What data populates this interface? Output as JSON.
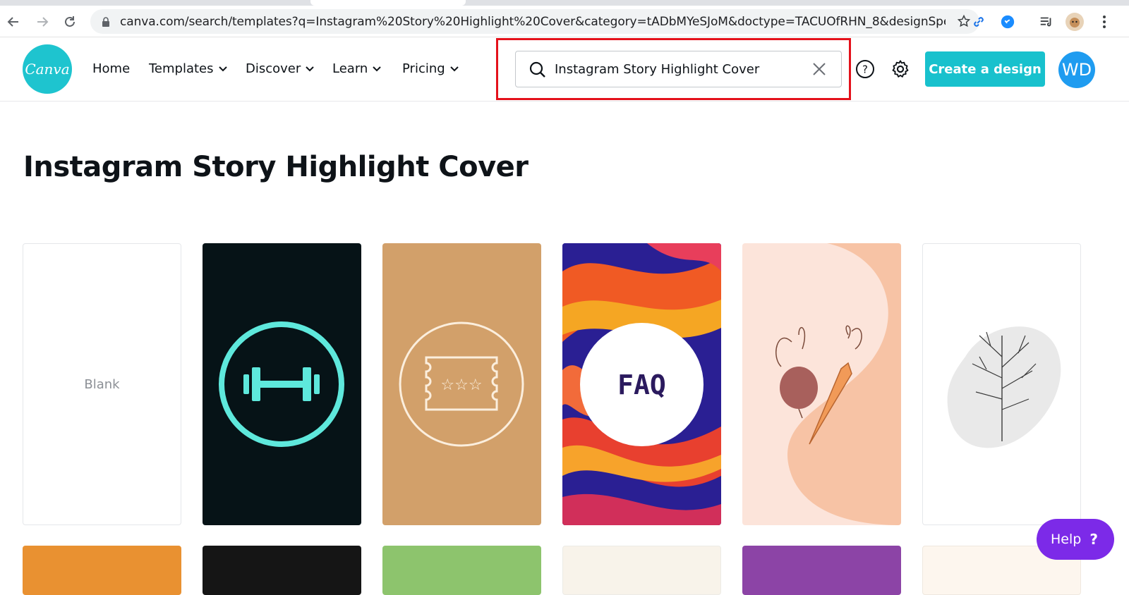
{
  "browser": {
    "url": "canva.com/search/templates?q=Instagram%20Story%20Highlight%20Cover&category=tADbMYeSJoM&doctype=TACUOfRHN_8&designSpec=dj..."
  },
  "header": {
    "logo_text": "Canva",
    "nav": [
      {
        "label": "Home"
      },
      {
        "label": "Templates"
      },
      {
        "label": "Discover"
      },
      {
        "label": "Learn"
      },
      {
        "label": "Pricing"
      }
    ],
    "search": {
      "value": "Instagram Story Highlight Cover"
    },
    "create_button": "Create a design",
    "avatar_initials": "WD"
  },
  "main": {
    "title": "Instagram Story Highlight Cover",
    "templates": [
      {
        "label": "Blank",
        "kind": "blank"
      },
      {
        "kind": "fitness",
        "background": "#061317",
        "accent": "#5ee8dc"
      },
      {
        "kind": "ticket",
        "background": "#d2a06a",
        "accent": "#fbeedd"
      },
      {
        "kind": "faq",
        "text": "FAQ",
        "accent": "#2b1a5e"
      },
      {
        "kind": "vegetables",
        "background": "#fce4da",
        "accent": "#f7c3a5"
      },
      {
        "kind": "plant",
        "background": "#ffffff",
        "accent": "#e9e9e9"
      }
    ],
    "templates_row2": [
      {
        "background": "#e99131"
      },
      {
        "background": "#151515"
      },
      {
        "background": "#8dc46d"
      },
      {
        "background": "#f8f3ea"
      },
      {
        "background": "#8c44a6"
      },
      {
        "background": "#fdf6ee"
      }
    ]
  },
  "help": {
    "label": "Help",
    "glyph": "?"
  }
}
